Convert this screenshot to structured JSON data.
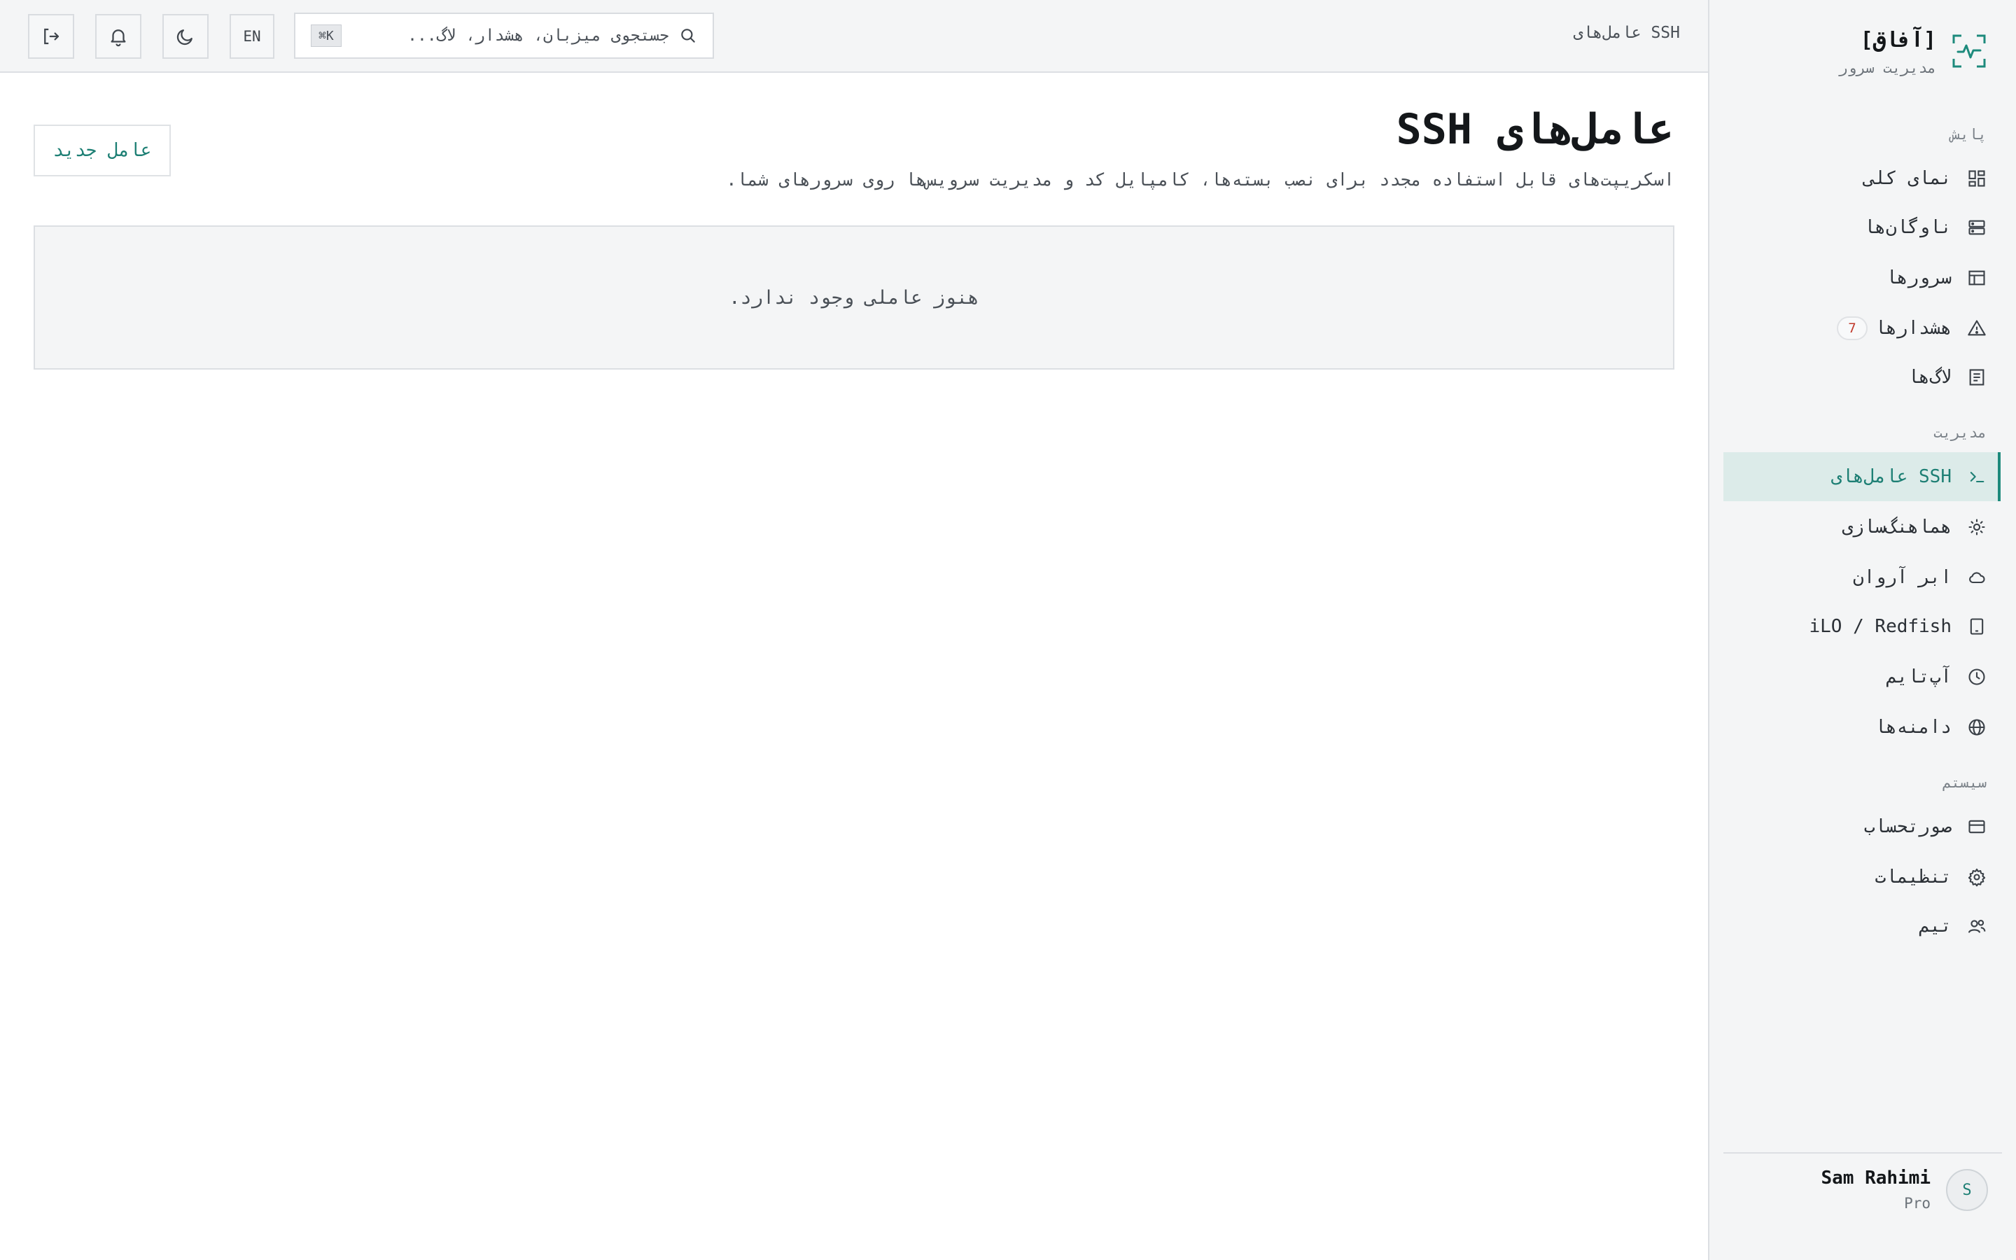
{
  "brand": {
    "title": "[آفاق]",
    "subtitle": "مدیریت سرور"
  },
  "sidebar": {
    "sections": [
      {
        "title": "پایش",
        "items": [
          {
            "label": "نمای کلی",
            "icon": "dashboard-icon"
          },
          {
            "label": "ناوگان‌ها",
            "icon": "server-stack-icon"
          },
          {
            "label": "سرورها",
            "icon": "table-icon"
          },
          {
            "label": "هشدارها",
            "icon": "warning-icon",
            "badge": "7"
          },
          {
            "label": "لاگ‌ها",
            "icon": "document-icon"
          }
        ]
      },
      {
        "title": "مدیریت",
        "items": [
          {
            "label": "عامل‌های SSH",
            "icon": "terminal-icon",
            "active": true
          },
          {
            "label": "هماهنگ‌سازی",
            "icon": "sun-icon"
          },
          {
            "label": "ابر آروان",
            "icon": "cloud-icon"
          },
          {
            "label": "iLO / Redfish",
            "icon": "tablet-icon"
          },
          {
            "label": "آپ‌تایم",
            "icon": "clock-icon"
          },
          {
            "label": "دامنه‌ها",
            "icon": "globe-icon"
          }
        ]
      },
      {
        "title": "سیستم",
        "items": [
          {
            "label": "صورتحساب",
            "icon": "credit-card-icon"
          },
          {
            "label": "تنظیمات",
            "icon": "gear-icon"
          },
          {
            "label": "تیم",
            "icon": "users-icon"
          }
        ]
      }
    ],
    "user": {
      "initial": "S",
      "name": "Sam Rahimi",
      "plan": "Pro"
    }
  },
  "topbar": {
    "breadcrumb": "عامل‌های SSH",
    "search_placeholder": "جستجوی میزبان، هشدار، لاگ...",
    "search_shortcut": "⌘K",
    "lang_label": "EN"
  },
  "main": {
    "title": "عامل‌های SSH",
    "description": "اسکریپت‌های قابل استفاده مجدد برای نصب بسته‌ها، کامپایل کد و مدیریت سرویس‌ها روی سرورهای شما.",
    "new_button": "عامل جدید",
    "empty_text": "هنوز عاملی وجود ندارد."
  },
  "colors": {
    "accent": "#1d7f74",
    "active_bg": "#dcebe9",
    "badge_text": "#c0392b"
  }
}
